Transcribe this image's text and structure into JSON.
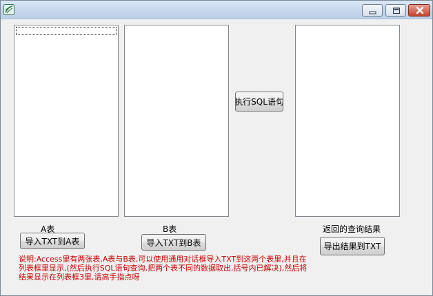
{
  "lists": {
    "a": {
      "items": []
    },
    "b": {
      "items": []
    },
    "result": {
      "items": []
    }
  },
  "buttons": {
    "execute_sql": "执行SQL语句",
    "import_a": "导入TXT到A表",
    "import_b": "导入TXT到B表",
    "export_result": "导出结果到TXT"
  },
  "labels": {
    "table_a": "A表",
    "table_b": "B表",
    "result": "返回的查询结果"
  },
  "description": "说明:Access里有两张表,A表与B表,可以使用通用对话框导入TXT到这两个表里,并且在列表框里显示,(然后执行SQL语句查询,把两个表不同的数据取出,括号内已解决),然后将结果显示在列表框3里,请高手指点呀",
  "colors": {
    "description_text": "#cc0000",
    "titlebar": "#c7d8ed",
    "close_button": "#c4432c"
  },
  "icons": {
    "app": "app-icon",
    "minimize": "minimize-icon",
    "maximize": "maximize-icon",
    "close": "close-icon"
  }
}
